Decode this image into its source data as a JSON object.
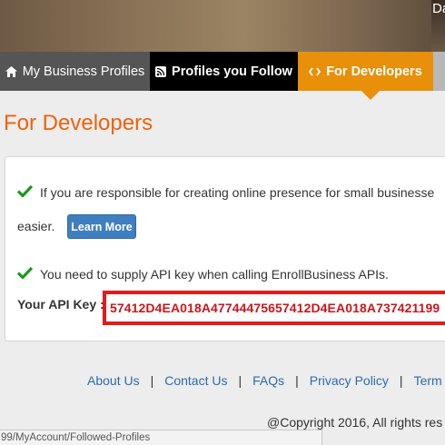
{
  "banner": {
    "user_text": "Da"
  },
  "nav": {
    "tabs": [
      {
        "label": "My Business Profiles",
        "icon": "home-icon"
      },
      {
        "label": "Profiles you Follow",
        "icon": "rss-icon"
      },
      {
        "label": "For Developers",
        "icon": "code-icon",
        "active": true
      }
    ],
    "active_color": "#e8900a"
  },
  "page": {
    "title": "For Developers",
    "info_text": "If you are responsible for creating online presence for small businesse",
    "info_text_cont": "easier.",
    "learn_more": "Learn More",
    "api_note": "You need to supply API key when calling EnrollBusiness APIs.",
    "api_label": "Your API Key :",
    "api_key": "57412D4EA018A47744475657412D4EA018A737421199"
  },
  "footer": {
    "links": [
      "About Us",
      "Contact Us",
      "FAQs",
      "Privacy Policy",
      "Term"
    ],
    "separator": "|",
    "copyright": "@Copyright 2016, All rights res"
  },
  "status_bar": {
    "url": "99/MyAccount/Followed-Profiles"
  },
  "colors": {
    "accent": "#f0620a",
    "check": "#1a9a1a",
    "api_key": "#c8171d",
    "highlight_border": "#e21b1b",
    "link": "#2b6cb0"
  }
}
